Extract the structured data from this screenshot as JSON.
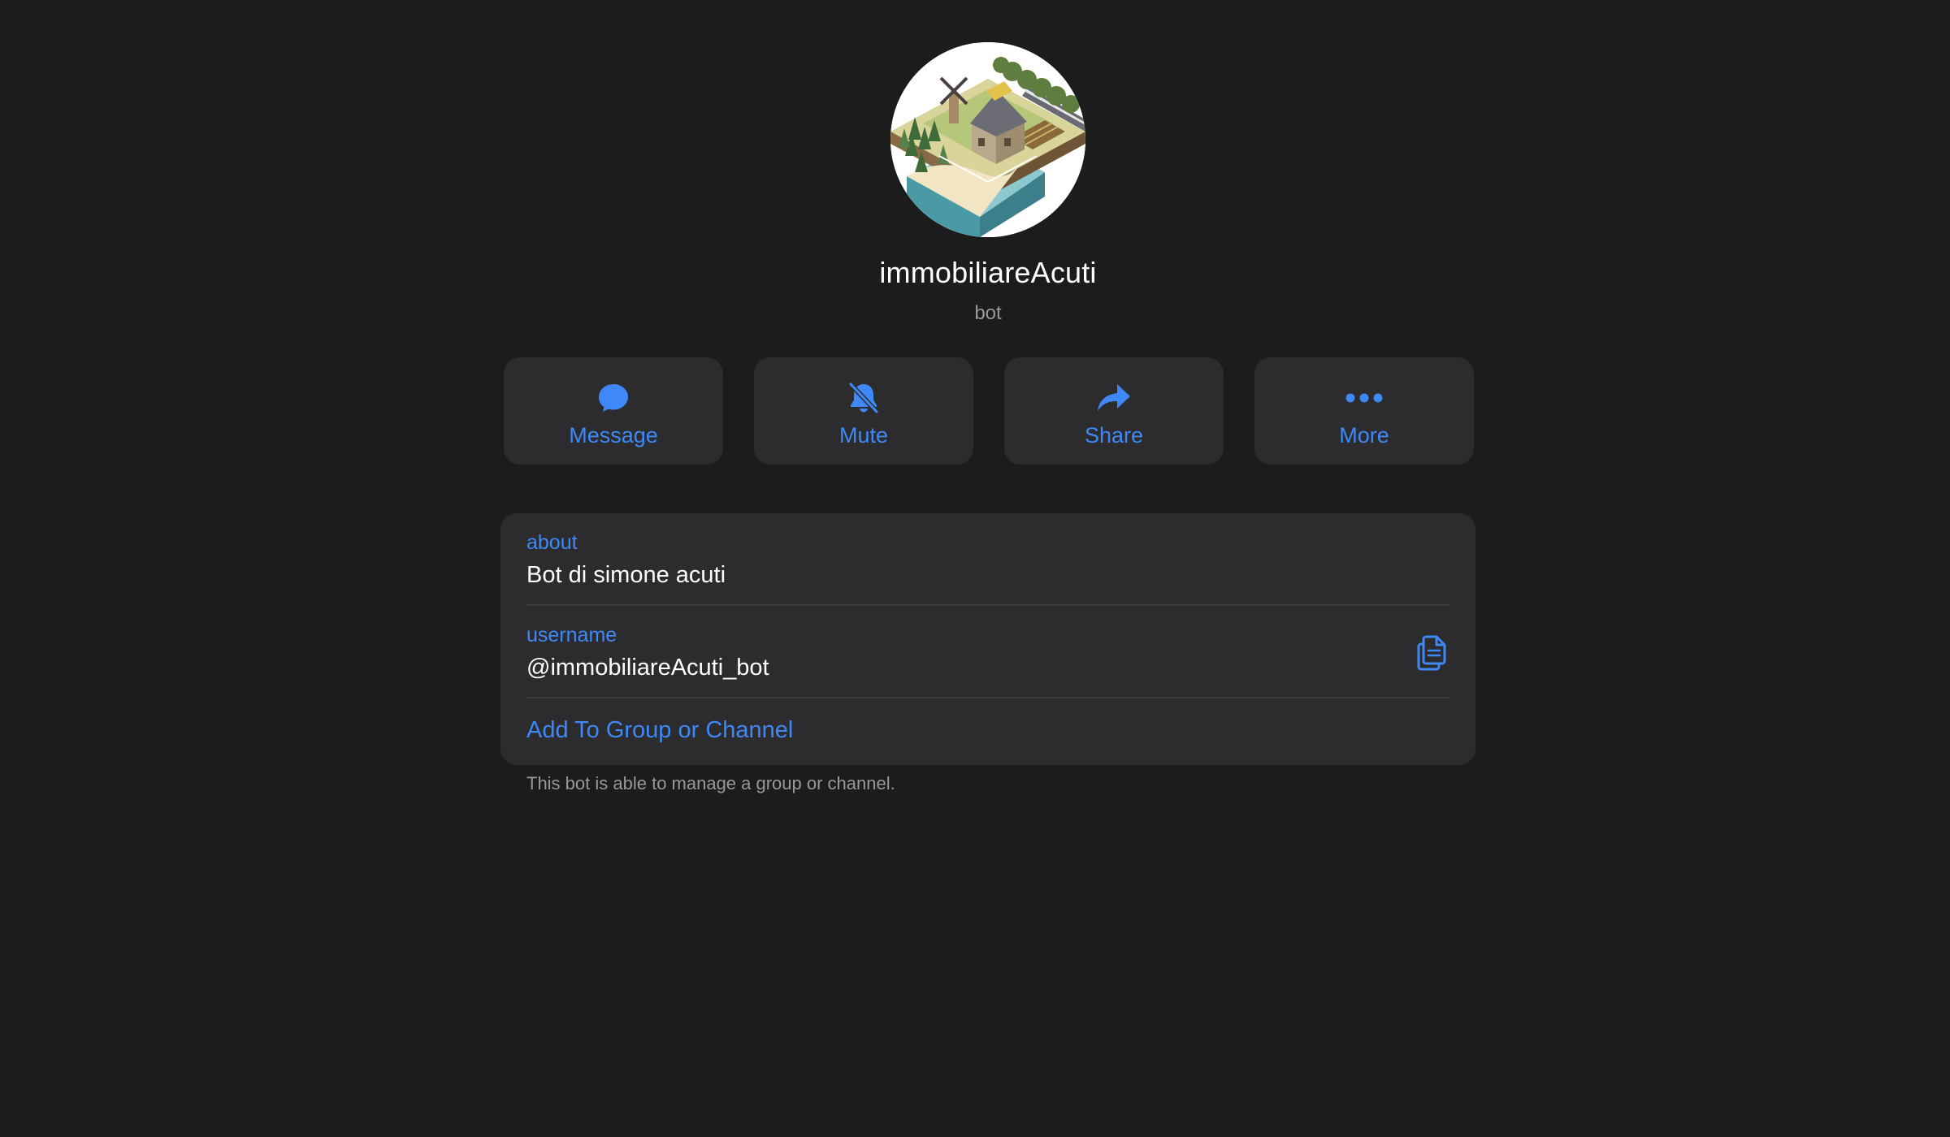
{
  "profile": {
    "name": "immobiliareAcuti",
    "status": "bot",
    "avatar_icon": "farm-illustration-avatar"
  },
  "actions": [
    {
      "label": "Message",
      "icon": "chat-bubble-icon"
    },
    {
      "label": "Mute",
      "icon": "bell-slash-icon"
    },
    {
      "label": "Share",
      "icon": "share-arrow-icon"
    },
    {
      "label": "More",
      "icon": "ellipsis-icon"
    }
  ],
  "info": {
    "about_label": "about",
    "about_value": "Bot di simone acuti",
    "username_label": "username",
    "username_value": "@immobiliareAcuti_bot",
    "copy_icon": "copy-icon",
    "add_link": "Add To Group or Channel"
  },
  "footnote": "This bot is able to manage a group or channel.",
  "colors": {
    "background": "#1c1c1d",
    "card": "#2c2c2e",
    "accent": "#3e88f7",
    "text_primary": "#ffffff",
    "text_secondary": "#98989e"
  }
}
